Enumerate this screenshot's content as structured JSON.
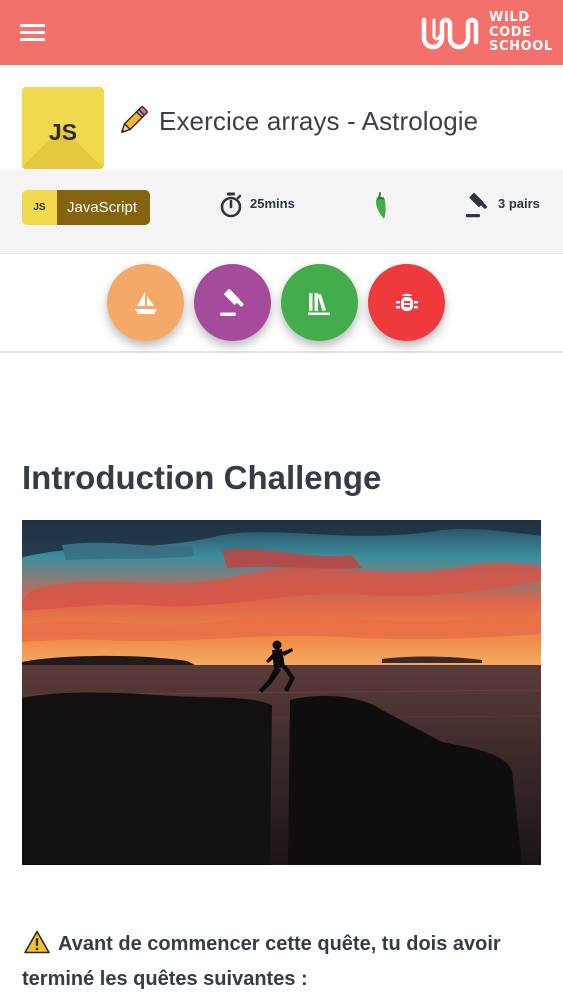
{
  "header": {
    "menu_icon": "hamburger-menu-icon",
    "logo": {
      "line1": "WILD",
      "line2": "CODE",
      "line3": "SCHOOL"
    },
    "bg_color": "#f4706d"
  },
  "quest": {
    "badge_label": "JS",
    "edit_icon": "pencil-icon",
    "title": "Exercice arrays - Astrologie"
  },
  "info": {
    "language": {
      "mini_label": "JS",
      "name": "JavaScript"
    },
    "duration": {
      "icon": "stopwatch-icon",
      "value": "25mins"
    },
    "difficulty": {
      "icon": "chili-pepper-icon",
      "color": "#42ad4a"
    },
    "workform": {
      "icon": "gavel-icon",
      "value": "3 pairs"
    }
  },
  "actions": [
    {
      "icon": "sailboat-icon",
      "color": "#f5a968"
    },
    {
      "icon": "gavel-icon",
      "color": "#a44c9b"
    },
    {
      "icon": "library-books-icon",
      "color": "#42ad4a"
    },
    {
      "icon": "bug-icon",
      "color": "#ef3a3d"
    }
  ],
  "content": {
    "heading": "Introduction Challenge",
    "hero_image": "silhouette-leaping-between-cliffs-at-sunset",
    "warning_icon": "warning-triangle-icon",
    "warning_text": "Avant de commencer cette quête, tu dois avoir terminé les quêtes suivantes :"
  }
}
